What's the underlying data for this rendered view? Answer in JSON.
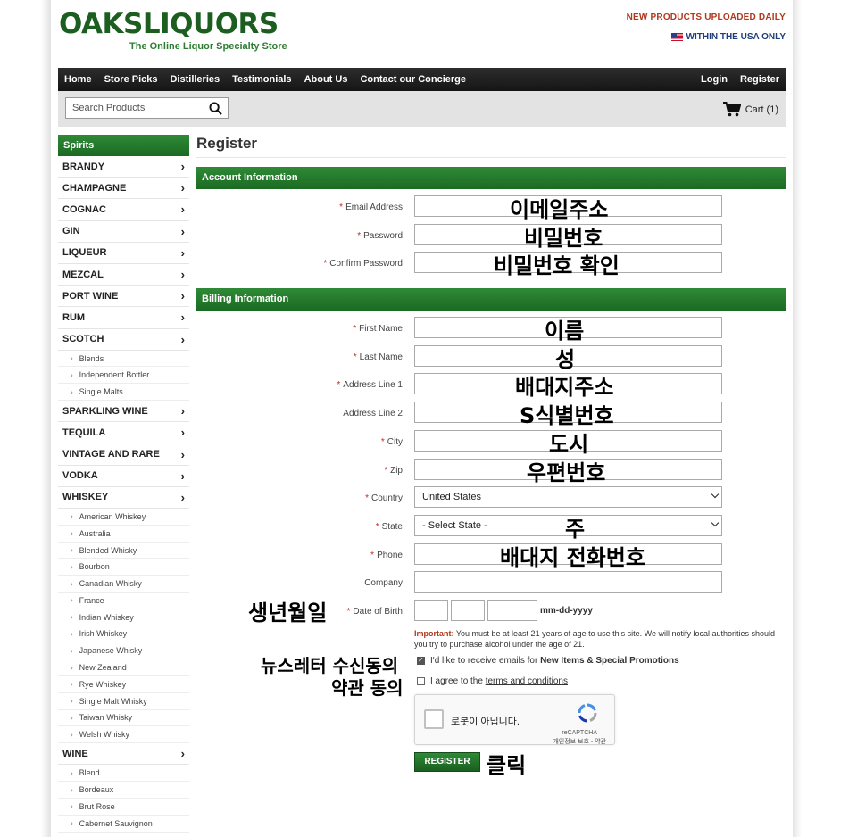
{
  "header": {
    "logo_left": "OAKS",
    "logo_right": "LIQUORS",
    "tagline": "The Online Liquor Specialty Store",
    "new_products": "NEW PRODUCTS UPLOADED DAILY",
    "within_usa": "WITHIN THE USA ONLY"
  },
  "nav": {
    "items": [
      "Home",
      "Store Picks",
      "Distilleries",
      "Testimonials",
      "About Us",
      "Contact our Concierge"
    ],
    "login": "Login",
    "register": "Register"
  },
  "search": {
    "placeholder": "Search Products"
  },
  "cart": {
    "label": "Cart (1)"
  },
  "sidebar": {
    "heading": "Spirits",
    "brandy": "BRANDY",
    "champagne": "CHAMPAGNE",
    "cognac": "COGNAC",
    "gin": "GIN",
    "liqueur": "LIQUEUR",
    "mezcal": "MEZCAL",
    "port_wine": "PORT WINE",
    "rum": "RUM",
    "scotch": "SCOTCH",
    "scotch_subs": [
      "Blends",
      "Independent Bottler",
      "Single Malts"
    ],
    "sparkling_wine": "SPARKLING WINE",
    "tequila": "TEQUILA",
    "vintage": "VINTAGE AND RARE",
    "vodka": "VODKA",
    "whiskey": "WHISKEY",
    "whiskey_subs": [
      "American Whiskey",
      "Australia",
      "Blended Whisky",
      "Bourbon",
      "Canadian Whisky",
      "France",
      "Indian Whiskey",
      "Irish Whiskey",
      "Japanese Whisky",
      "New Zealand",
      "Rye Whiskey",
      "Single Malt Whisky",
      "Taiwan Whisky",
      "Welsh Whisky"
    ],
    "wine": "WINE",
    "wine_subs": [
      "Blend",
      "Bordeaux",
      "Brut Rose",
      "Cabernet Sauvignon"
    ]
  },
  "form": {
    "title": "Register",
    "account_heading": "Account Information",
    "billing_heading": "Billing Information",
    "required_mark": "*",
    "email_label": "Email Address",
    "password_label": "Password",
    "confirm_label": "Confirm Password",
    "first_label": "First Name",
    "last_label": "Last Name",
    "addr1_label": "Address Line 1",
    "addr2_label": "Address Line 2",
    "city_label": "City",
    "zip_label": "Zip",
    "country_label": "Country",
    "country_value": "United States",
    "state_label": "State",
    "state_value": "- Select State -",
    "phone_label": "Phone",
    "company_label": "Company",
    "dob_label": "Date of Birth",
    "dob_format": "mm-dd-yyyy",
    "important_label": "Important:",
    "important_text": " You must be at least 21 years of age to use this site. We will notify local authorities should you try to purchase alcohol under the age of 21.",
    "newsletter_text": "I'd like to receive emails for ",
    "newsletter_bold": "New Items & Special Promotions",
    "terms_text": "I agree to the ",
    "terms_link": "terms and conditions",
    "captcha_label": "로봇이 아닙니다.",
    "captcha_brand": "reCAPTCHA",
    "captcha_privacy": "개인정보 보호 - 약관",
    "register_button": "REGISTER"
  },
  "annotations": {
    "email": "이메일주소",
    "password": "비밀번호",
    "confirm": "비밀번호 확인",
    "first": "이름",
    "last": "성",
    "addr1": "배대지주소",
    "addr2": "S식별번호",
    "city": "도시",
    "zip": "우편번호",
    "state": "주",
    "phone": "배대지 전화번호",
    "dob": "생년월일",
    "newsletter": "뉴스레터 수신동의",
    "terms": "약관 동의",
    "register": "클릭"
  },
  "colors": {
    "brand_green": "#1b6a23",
    "accent_red": "#b0381c",
    "nav_dark": "#1e1e1e"
  }
}
